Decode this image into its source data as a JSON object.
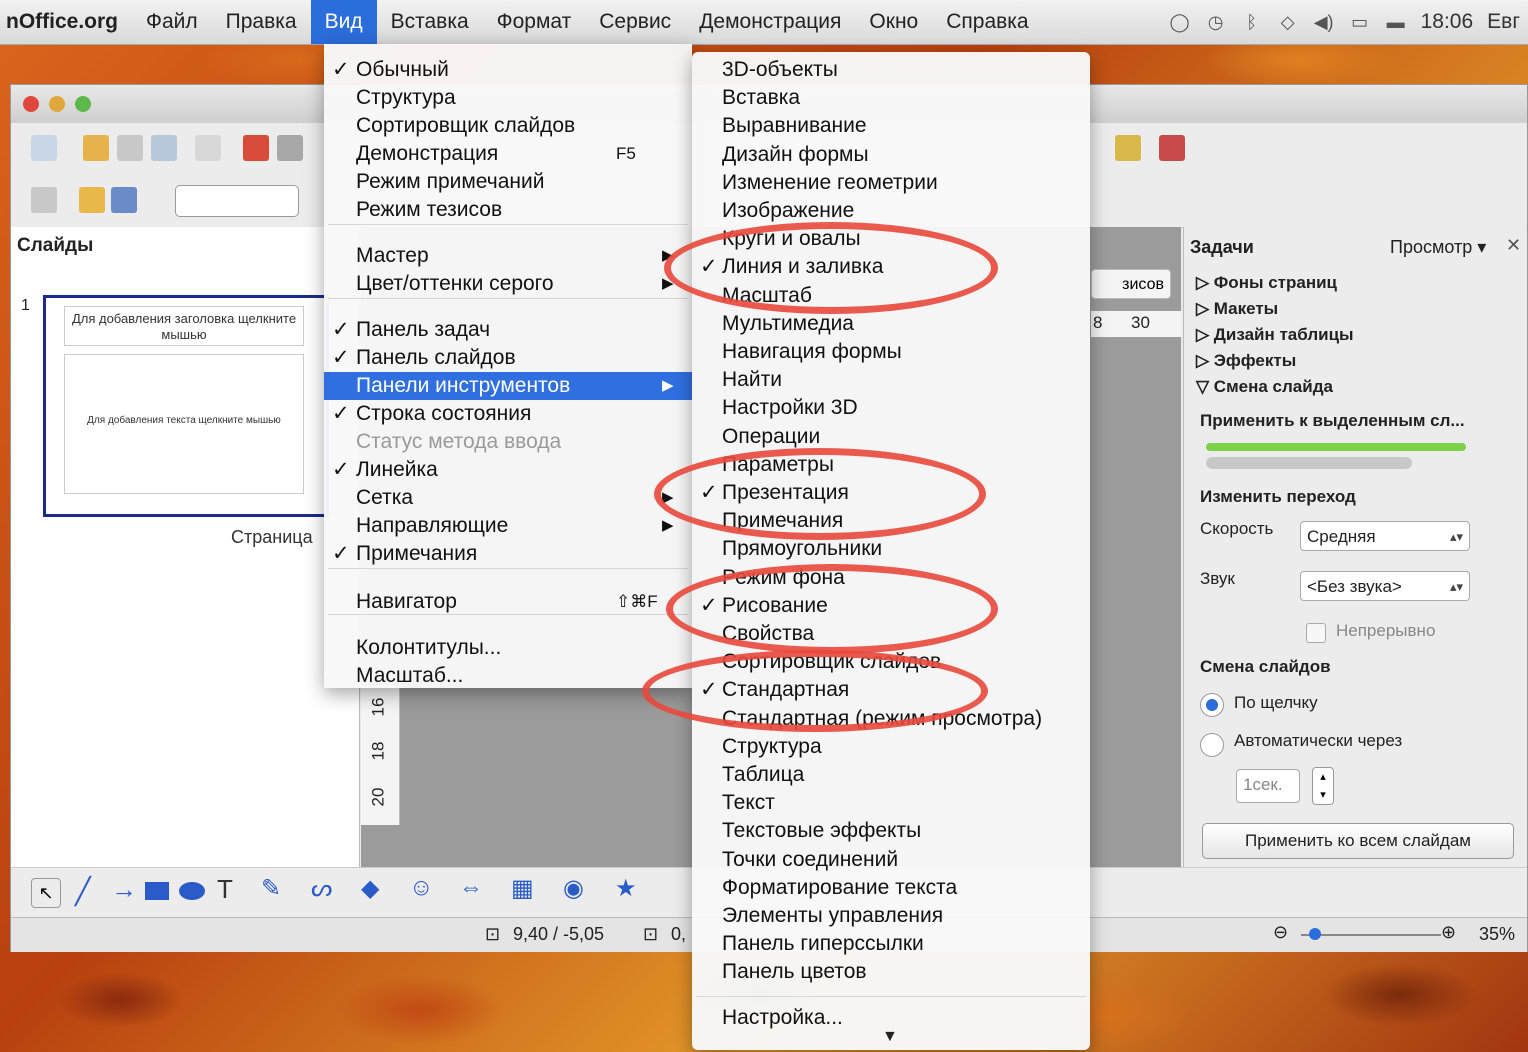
{
  "menubar": {
    "app": "nOffice.org",
    "items": [
      "Файл",
      "Правка",
      "Вид",
      "Вставка",
      "Формат",
      "Сервис",
      "Демонстрация",
      "Окно",
      "Справка"
    ],
    "active": "Вид",
    "clock": "18:06",
    "user": "Евг"
  },
  "slides_pane": {
    "title": "Слайды",
    "slide_number": "1",
    "thumb_title": "Для добавления заголовка щелкните мышью",
    "thumb_body": "Для добавления текста щелкните мышью",
    "page_label": "Страница"
  },
  "editor": {
    "ruler_top": [
      "8",
      "30"
    ],
    "ruler_left": [
      "16",
      "18",
      "20"
    ],
    "right_tab": "зисов"
  },
  "task_pane": {
    "title": "Задачи",
    "view": "Просмотр",
    "sections": [
      "Фоны страниц",
      "Макеты",
      "Дизайн таблицы",
      "Эффекты",
      "Смена слайда"
    ],
    "apply_selected": "Применить к выделенным сл...",
    "change_transition": "Изменить переход",
    "speed_label": "Скорость",
    "speed_value": "Средняя",
    "sound_label": "Звук",
    "sound_value": "<Без звука>",
    "loop_label": "Непрерывно",
    "advance_title": "Смена слайдов",
    "on_click": "По щелчку",
    "auto_after": "Автоматически через",
    "seconds_value": "1сек.",
    "apply_all": "Применить ко всем слайдам"
  },
  "statusbar": {
    "position": "9,40 / -5,05",
    "size": "0,",
    "zoom": "35%"
  },
  "view_menu": {
    "items": [
      {
        "label": "Обычный",
        "checked": true
      },
      {
        "label": "Структура"
      },
      {
        "label": "Сортировщик слайдов"
      },
      {
        "label": "Демонстрация",
        "shortcut": "F5"
      },
      {
        "label": "Режим примечаний"
      },
      {
        "label": "Режим тезисов"
      },
      {
        "label": "Мастер",
        "submenu": true
      },
      {
        "label": "Цвет/оттенки серого",
        "submenu": true
      },
      {
        "label": "Панель задач",
        "checked": true
      },
      {
        "label": "Панель слайдов",
        "checked": true
      },
      {
        "label": "Панели инструментов",
        "submenu": true,
        "highlighted": true
      },
      {
        "label": "Строка состояния",
        "checked": true
      },
      {
        "label": "Статус метода ввода",
        "disabled": true
      },
      {
        "label": "Линейка",
        "checked": true
      },
      {
        "label": "Сетка",
        "submenu": true
      },
      {
        "label": "Направляющие",
        "submenu": true
      },
      {
        "label": "Примечания",
        "checked": true
      },
      {
        "label": "Навигатор",
        "shortcut": "⇧⌘F"
      },
      {
        "label": "Колонтитулы..."
      },
      {
        "label": "Масштаб..."
      }
    ]
  },
  "toolbars_menu": {
    "items": [
      {
        "label": "3D-объекты"
      },
      {
        "label": "Вставка"
      },
      {
        "label": "Выравнивание"
      },
      {
        "label": "Дизайн формы"
      },
      {
        "label": "Изменение геометрии"
      },
      {
        "label": "Изображение"
      },
      {
        "label": "Круги и овалы"
      },
      {
        "label": "Линия и заливка",
        "checked": true
      },
      {
        "label": "Масштаб"
      },
      {
        "label": "Мультимедиа"
      },
      {
        "label": "Навигация формы"
      },
      {
        "label": "Найти"
      },
      {
        "label": "Настройки 3D"
      },
      {
        "label": "Операции"
      },
      {
        "label": "Параметры"
      },
      {
        "label": "Презентация",
        "checked": true
      },
      {
        "label": "Примечания"
      },
      {
        "label": "Прямоугольники"
      },
      {
        "label": "Режим фона"
      },
      {
        "label": "Рисование",
        "checked": true
      },
      {
        "label": "Свойства"
      },
      {
        "label": "Сортировщик слайдов"
      },
      {
        "label": "Стандартная",
        "checked": true
      },
      {
        "label": "Стандартная (режим просмотра)"
      },
      {
        "label": "Структура"
      },
      {
        "label": "Таблица"
      },
      {
        "label": "Текст"
      },
      {
        "label": "Текстовые эффекты"
      },
      {
        "label": "Точки соединений"
      },
      {
        "label": "Форматирование текста"
      },
      {
        "label": "Элементы управления"
      },
      {
        "label": "Панель гиперссылки"
      },
      {
        "label": "Панель цветов"
      },
      {
        "label": "Настройка..."
      }
    ]
  },
  "colors": {
    "highlight": "#2f6fe0",
    "annotation": "#e8483c",
    "slide_border": "#1c2a8c"
  }
}
